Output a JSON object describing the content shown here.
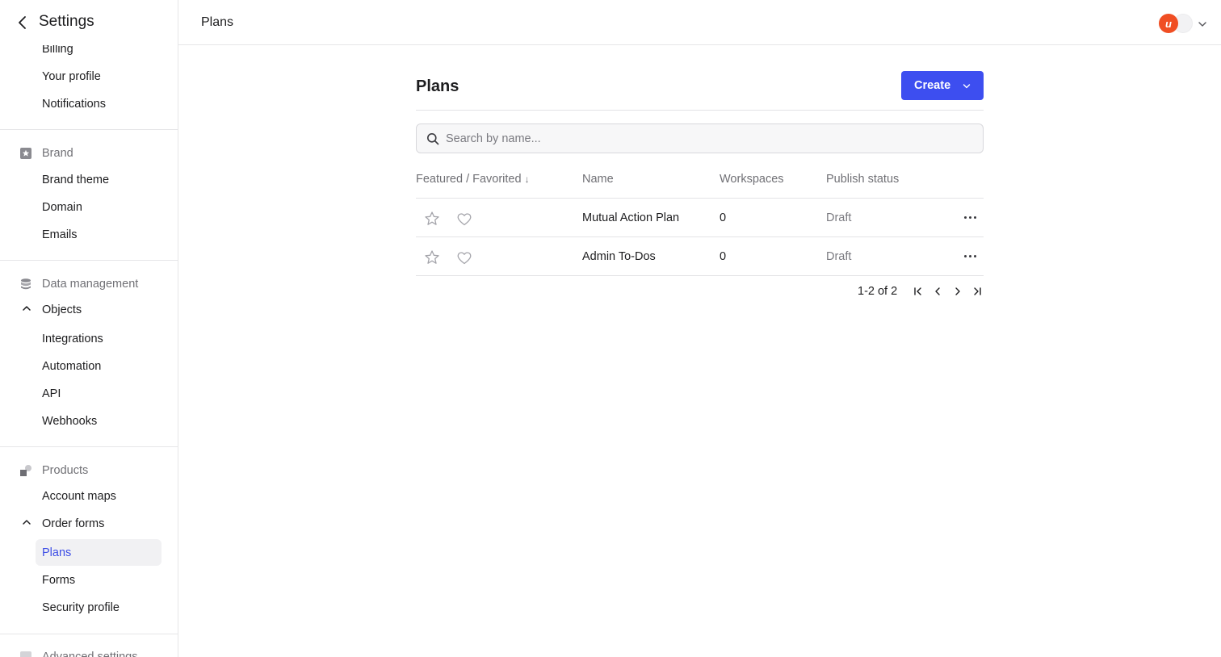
{
  "sidebar": {
    "title": "Settings",
    "top_items": [
      "Billing",
      "Your profile",
      "Notifications"
    ],
    "brand": {
      "label": "Brand",
      "icon": "star-square-icon",
      "items": [
        "Brand theme",
        "Domain",
        "Emails"
      ]
    },
    "data_management": {
      "label": "Data management",
      "icon": "database-icon",
      "objects_label": "Objects",
      "items": [
        "Integrations",
        "Automation",
        "API",
        "Webhooks"
      ]
    },
    "products": {
      "label": "Products",
      "icon": "products-icon",
      "account_maps": "Account maps",
      "order_forms_label": "Order forms",
      "items": [
        "Plans",
        "Forms",
        "Security profile"
      ],
      "active_item": "Plans"
    },
    "advanced_label": "Advanced settings"
  },
  "topbar": {
    "title": "Plans",
    "avatar_initial": "u"
  },
  "main": {
    "title": "Plans",
    "create_label": "Create",
    "search_placeholder": "Search by name...",
    "columns": {
      "featured": "Featured / Favorited",
      "name": "Name",
      "workspaces": "Workspaces",
      "status": "Publish status"
    },
    "rows": [
      {
        "name": "Mutual Action Plan",
        "workspaces": "0",
        "status": "Draft"
      },
      {
        "name": "Admin To-Dos",
        "workspaces": "0",
        "status": "Draft"
      }
    ],
    "pagination": "1-2 of 2"
  },
  "colors": {
    "accent": "#3d4ef0",
    "active_text": "#3d4ee6",
    "avatar": "#f04e23",
    "muted_text": "#707075"
  }
}
